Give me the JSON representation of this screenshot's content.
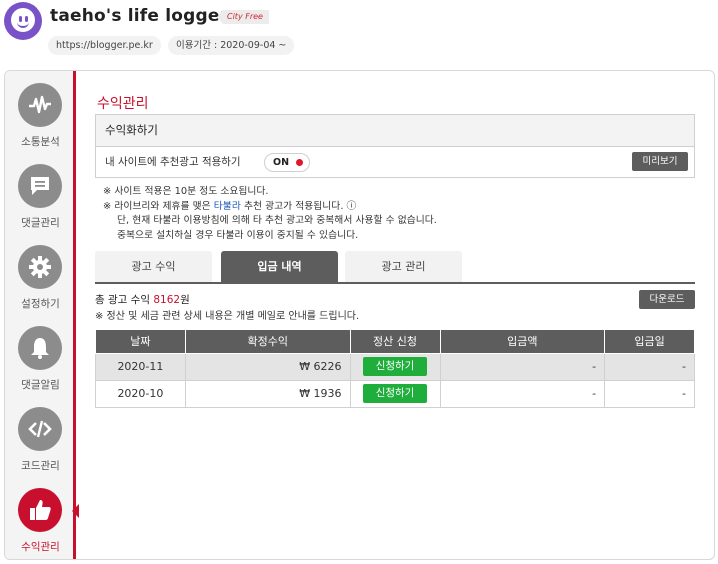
{
  "header": {
    "site_title": "taeho's life logger",
    "badge": "City Free",
    "url": "https://blogger.pe.kr",
    "period": "이용기간 : 2020-09-04 ~"
  },
  "sidebar": {
    "items": [
      {
        "label": "소통분석",
        "icon": "pulse-icon"
      },
      {
        "label": "댓글관리",
        "icon": "comment-icon"
      },
      {
        "label": "설정하기",
        "icon": "gear-icon"
      },
      {
        "label": "댓글알림",
        "icon": "bell-icon"
      },
      {
        "label": "코드관리",
        "icon": "code-icon"
      },
      {
        "label": "수익관리",
        "icon": "thumbs-up-icon",
        "active": true
      }
    ],
    "accent_color": "#c8102e"
  },
  "main": {
    "section_title": "수익관리",
    "monetize": {
      "title": "수익화하기",
      "apply_label": "내 사이트에 추천광고 적용하기",
      "toggle_label": "ON",
      "preview_button": "미리보기"
    },
    "notes": {
      "line1": "※ 사이트 적용은 10분 정도 소요됩니다.",
      "line2_pre": "※ 라이브리와 제휴를 맺은 ",
      "line2_link": "타불라",
      "line2_post": " 추천 광고가 적용됩니다. ⓘ",
      "line3": "단, 현재 타불라 이용방침에 의해 타 추천 광고와 중복해서 사용할 수 없습니다.",
      "line4": "중복으로 설치하실 경우 타불라 이용이 중지될 수 있습니다."
    },
    "tabs": [
      {
        "label": "광고 수익"
      },
      {
        "label": "입금 내역",
        "active": true
      },
      {
        "label": "광고 관리"
      }
    ],
    "total": {
      "prefix": "총 광고 수익 ",
      "amount": "8162",
      "suffix": "원"
    },
    "mail_note": "※ 정산 및 세금 관련 상세 내용은 개별 메일로 안내를 드립니다.",
    "download_button": "다운로드",
    "table": {
      "headers": [
        "날짜",
        "확정수익",
        "정산 신청",
        "입금액",
        "입금일"
      ],
      "rows": [
        {
          "date": "2020-11",
          "revenue": "₩ 6226",
          "action": "신청하기",
          "deposit": "-",
          "deposit_date": "-"
        },
        {
          "date": "2020-10",
          "revenue": "₩ 1936",
          "action": "신청하기",
          "deposit": "-",
          "deposit_date": "-"
        }
      ]
    }
  }
}
